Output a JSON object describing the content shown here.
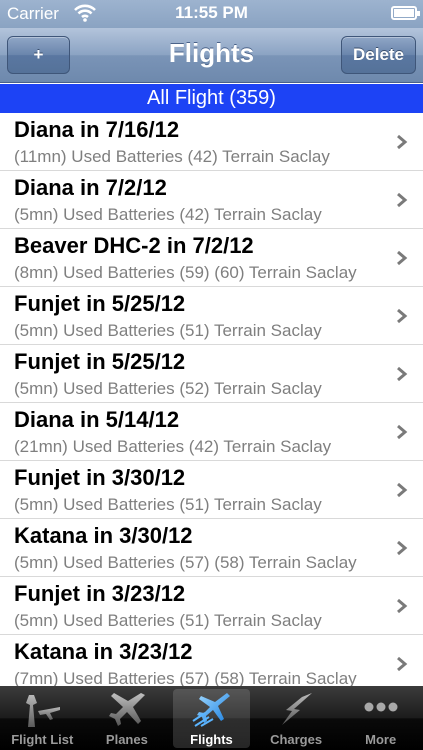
{
  "status_bar": {
    "carrier": "Carrier",
    "time": "11:55 PM"
  },
  "nav_bar": {
    "title": "Flights",
    "add_label": "+",
    "delete_label": "Delete"
  },
  "section_header": "All Flight (359)",
  "rows": [
    {
      "title": "Diana in 7/16/12",
      "subtitle": "(11mn) Used Batteries (42)  Terrain Saclay"
    },
    {
      "title": "Diana in 7/2/12",
      "subtitle": "(5mn) Used Batteries (42)  Terrain Saclay"
    },
    {
      "title": "Beaver DHC-2 in 7/2/12",
      "subtitle": "(8mn) Used Batteries (59) (60)  Terrain Saclay"
    },
    {
      "title": "Funjet in 5/25/12",
      "subtitle": "(5mn) Used Batteries (51)  Terrain Saclay"
    },
    {
      "title": "Funjet in 5/25/12",
      "subtitle": "(5mn) Used Batteries (52)  Terrain Saclay"
    },
    {
      "title": "Diana in 5/14/12",
      "subtitle": "(21mn) Used Batteries (42)  Terrain Saclay"
    },
    {
      "title": "Funjet in 3/30/12",
      "subtitle": "(5mn) Used Batteries (51)  Terrain Saclay"
    },
    {
      "title": "Katana in 3/30/12",
      "subtitle": "(5mn) Used Batteries (57) (58)  Terrain Saclay"
    },
    {
      "title": "Funjet in 3/23/12",
      "subtitle": "(5mn) Used Batteries (51)  Terrain Saclay"
    },
    {
      "title": "Katana in 3/23/12",
      "subtitle": "(7mn) Used Batteries (57) (58)  Terrain Saclay"
    }
  ],
  "tabs": [
    {
      "label": "Flight List",
      "icon": "tower-plane-icon"
    },
    {
      "label": "Planes",
      "icon": "plane-icon"
    },
    {
      "label": "Flights",
      "icon": "flying-plane-icon",
      "active": true
    },
    {
      "label": "Charges",
      "icon": "lightning-icon"
    },
    {
      "label": "More",
      "icon": "more-dots-icon"
    }
  ]
}
